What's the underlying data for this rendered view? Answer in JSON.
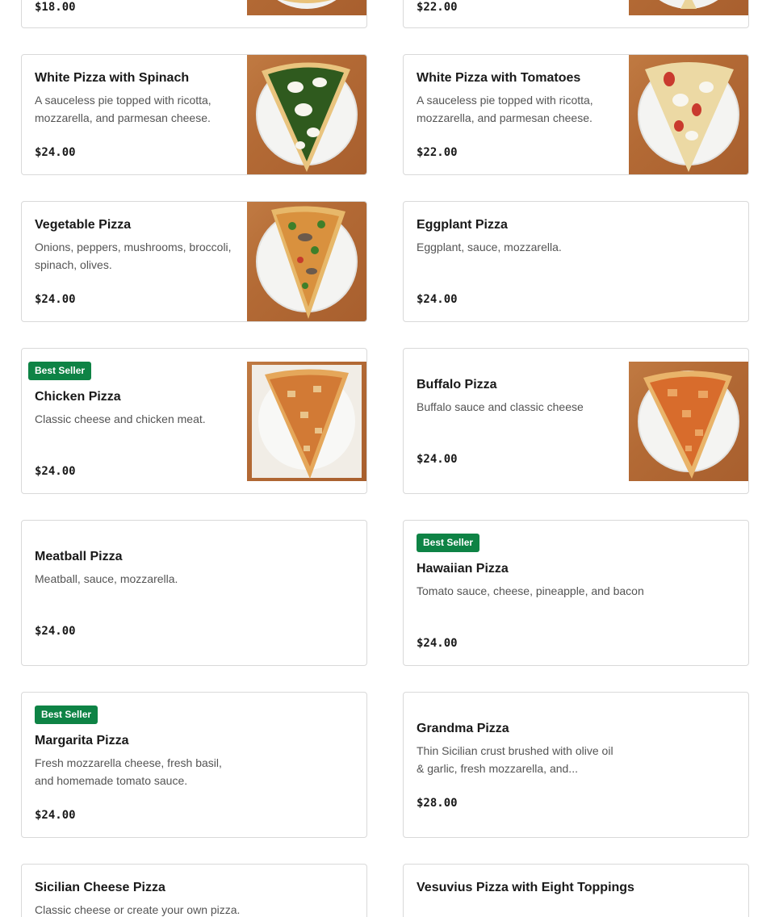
{
  "menu": {
    "items": [
      {
        "price": "$18.00"
      },
      {
        "price": "$22.00"
      },
      {
        "name": "White Pizza with Spinach",
        "description": "A sauceless pie topped with ricotta, mozzarella, and parmesan cheese.",
        "price": "$24.00",
        "image": "spinach-pizza-slice"
      },
      {
        "name": "White Pizza with Tomatoes",
        "description": "A sauceless pie topped with ricotta, mozzarella, and parmesan cheese.",
        "price": "$22.00",
        "image": "tomato-white-pizza-slice"
      },
      {
        "name": "Vegetable Pizza",
        "description": "Onions, peppers, mushrooms, broccoli, spinach, olives.",
        "price": "$24.00",
        "image": "vegetable-pizza-slice"
      },
      {
        "name": "Eggplant Pizza",
        "description": "Eggplant, sauce, mozzarella.",
        "price": "$24.00"
      },
      {
        "badge": "Best Seller",
        "name": "Chicken Pizza",
        "description": "Classic cheese and chicken meat.",
        "price": "$24.00",
        "image": "chicken-pizza-slice"
      },
      {
        "name": "Buffalo Pizza",
        "description": "Buffalo sauce and classic cheese",
        "price": "$24.00",
        "image": "buffalo-pizza-slice"
      },
      {
        "name": "Meatball Pizza",
        "description": "Meatball, sauce, mozzarella.",
        "price": "$24.00"
      },
      {
        "badge": "Best Seller",
        "name": "Hawaiian Pizza",
        "description": "Tomato sauce, cheese, pineapple, and bacon",
        "price": "$24.00"
      },
      {
        "badge": "Best Seller",
        "name": "Margarita Pizza",
        "description": "Fresh mozzarella cheese, fresh basil, and homemade tomato sauce.",
        "price": "$24.00"
      },
      {
        "name": "Grandma Pizza",
        "description": "Thin Sicilian crust brushed with olive oil & garlic, fresh mozzarella, and...",
        "price": "$28.00"
      },
      {
        "name": "Sicilian Cheese Pizza",
        "description": "Classic cheese or create your own pizza."
      },
      {
        "name": "Vesuvius Pizza with Eight Toppings"
      }
    ]
  },
  "colors": {
    "badge": "#0e8345",
    "border": "#d9d9d9",
    "description": "#545454",
    "wood": "#b36a35"
  }
}
